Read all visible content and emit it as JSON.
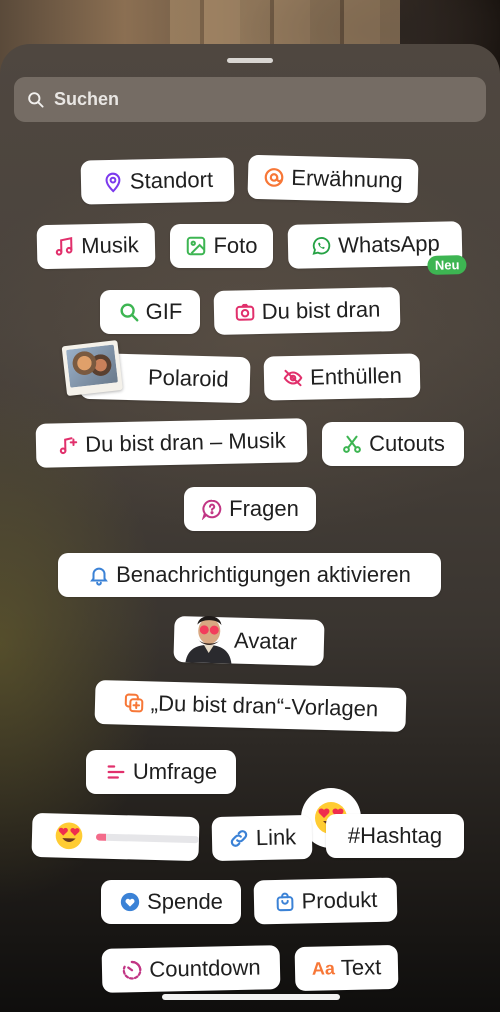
{
  "search": {
    "placeholder": "Suchen"
  },
  "stickers": {
    "standort": "Standort",
    "erwaehnung": "Erwähnung",
    "musik": "Musik",
    "foto": "Foto",
    "whatsapp": "WhatsApp",
    "neu_badge": "Neu",
    "gif": "GIF",
    "du_bist_dran": "Du bist dran",
    "polaroid": "Polaroid",
    "enthuellen": "Enthüllen",
    "du_bist_dran_musik": "Du bist dran – Musik",
    "cutouts": "Cutouts",
    "fragen": "Fragen",
    "benachrichtigungen": "Benachrichtigungen aktivieren",
    "avatar": "Avatar",
    "vorlagen": "„Du bist dran“-Vorlagen",
    "umfrage": "Umfrage",
    "link": "Link",
    "hashtag": "#Hashtag",
    "spende": "Spende",
    "produkt": "Produkt",
    "countdown": "Countdown",
    "text": "Text"
  },
  "icons": {
    "standort": "location-pin-icon",
    "erwaehnung": "threads-at-icon",
    "musik": "music-note-icon",
    "foto": "photo-icon",
    "whatsapp": "whatsapp-icon",
    "gif": "search-icon",
    "du_bist_dran": "camera-icon",
    "enthuellen": "eye-slash-icon",
    "du_bist_dran_musik": "music-plus-icon",
    "cutouts": "scissors-icon",
    "fragen": "question-bubble-icon",
    "benachrichtigungen": "bell-icon",
    "vorlagen": "template-copy-icon",
    "umfrage": "poll-lines-icon",
    "link": "link-icon",
    "spende": "heart-donate-icon",
    "produkt": "shopping-bag-icon",
    "countdown": "countdown-timer-icon",
    "text": "text-aa-icon",
    "emoji": "heart-eyes-emoji"
  },
  "colors": {
    "purple": "#8a3ab9",
    "orange": "#f77737",
    "pink": "#e1306c",
    "green": "#3db552",
    "blue": "#3b82d6"
  },
  "emoji_slider": {
    "level": 0.1
  }
}
